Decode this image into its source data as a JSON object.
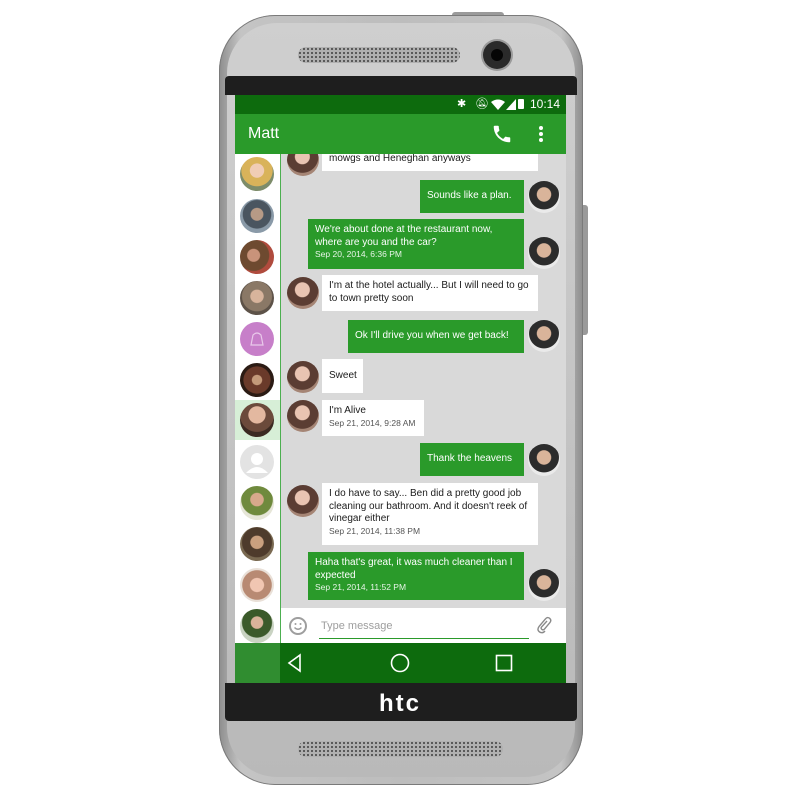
{
  "device": {
    "brand_logo": "htc"
  },
  "status_bar": {
    "time": "10:14",
    "icons": [
      "bluetooth-icon",
      "mute-icon",
      "wifi-icon",
      "signal-icon",
      "battery-icon"
    ]
  },
  "app_bar": {
    "title": "Matt",
    "actions": [
      "call-icon",
      "overflow-menu-icon"
    ]
  },
  "colors": {
    "accent": "#2a9a2a",
    "dark_accent": "#0d6b0d",
    "chat_bg": "#d9d9d9",
    "incoming_bubble": "#ffffff"
  },
  "contacts": [
    {
      "name": "contact-1"
    },
    {
      "name": "contact-2"
    },
    {
      "name": "contact-3"
    },
    {
      "name": "contact-4"
    },
    {
      "name": "contact-5"
    },
    {
      "name": "contact-6"
    },
    {
      "name": "contact-7-selected"
    },
    {
      "name": "contact-8"
    },
    {
      "name": "contact-9"
    },
    {
      "name": "contact-10"
    },
    {
      "name": "contact-11"
    },
    {
      "name": "contact-12"
    }
  ],
  "messages": [
    {
      "dir": "in",
      "text": "mowgs and Heneghan anyways",
      "time": ""
    },
    {
      "dir": "out",
      "text": "Sounds like a plan.",
      "time": ""
    },
    {
      "dir": "out",
      "text": "We're about done at the restaurant now, where are you and the car?",
      "time": "Sep 20, 2014, 6:36 PM"
    },
    {
      "dir": "in",
      "text": "I'm at the hotel actually... But I will need to go to town pretty soon",
      "time": ""
    },
    {
      "dir": "out",
      "text": "Ok I'll drive you when we get back!",
      "time": ""
    },
    {
      "dir": "in",
      "text": "Sweet",
      "time": ""
    },
    {
      "dir": "in",
      "text": "I'm Alive",
      "time": "Sep 21, 2014, 9:28 AM"
    },
    {
      "dir": "out",
      "text": "Thank the heavens",
      "time": ""
    },
    {
      "dir": "in",
      "text": "I do have to say... Ben did a pretty good job cleaning our bathroom. And it doesn't reek of vinegar either",
      "time": "Sep 21, 2014, 11:38 PM"
    },
    {
      "dir": "out",
      "text": "Haha that's great, it was much cleaner than I expected",
      "time": "Sep 21, 2014, 11:52 PM"
    }
  ],
  "composer": {
    "placeholder": "Type message"
  },
  "nav": {
    "buttons": [
      "back-icon",
      "home-icon",
      "recents-icon"
    ]
  }
}
